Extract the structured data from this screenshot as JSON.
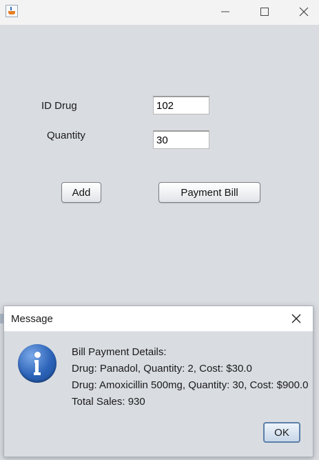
{
  "window": {
    "title": "",
    "app_icon": "java-cup-icon",
    "controls": [
      "minimize-icon",
      "maximize-icon",
      "close-icon"
    ]
  },
  "form": {
    "id_label": "ID Drug",
    "id_value": "102",
    "quantity_label": "Quantity",
    "quantity_value": "30",
    "add_label": "Add",
    "payment_label": "Payment Bill"
  },
  "dialog": {
    "title": "Message",
    "icon": "info-icon",
    "lines": [
      "Bill Payment Details:",
      "Drug: Panadol, Quantity: 2, Cost: $30.0",
      "Drug: Amoxicillin 500mg, Quantity: 30, Cost: $900.0",
      "Total Sales: 930"
    ],
    "ok_label": "OK"
  },
  "colors": {
    "background": "#d9dce1",
    "info_blue": "#2c63b8",
    "ok_border": "#5a7fa8"
  }
}
